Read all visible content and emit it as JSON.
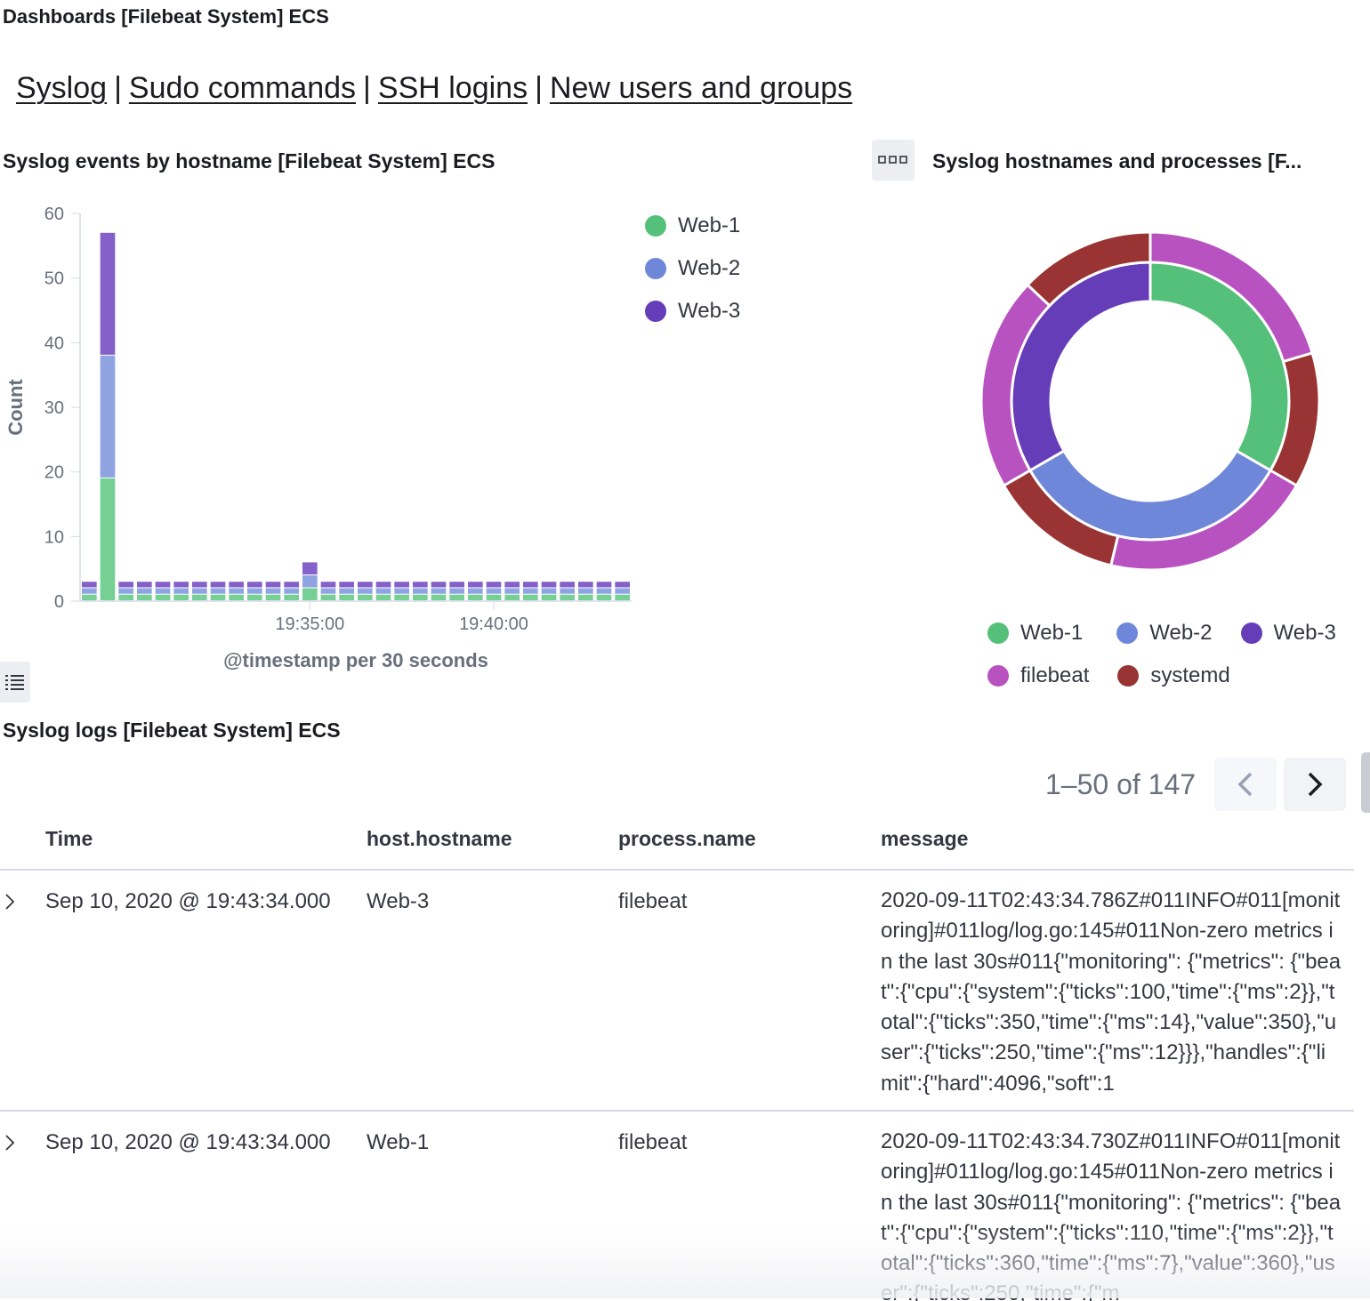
{
  "page_title": "Dashboards [Filebeat System] ECS",
  "nav": {
    "links": [
      "Syslog",
      "Sudo commands",
      "SSH logins",
      "New users and groups"
    ],
    "separator": "|"
  },
  "bar_panel": {
    "title": "Syslog events by hostname [Filebeat System] ECS",
    "legend": [
      {
        "label": "Web-1",
        "color": "#54b399"
      },
      {
        "label": "Web-2",
        "color": "#6f87d8"
      },
      {
        "label": "Web-3",
        "color": "#663db8"
      }
    ]
  },
  "donut_panel": {
    "title": "Syslog hostnames and processes [F...",
    "menu_icon": "ellipsis-icon",
    "legend": [
      {
        "label": "Web-1",
        "color": "#54c07a"
      },
      {
        "label": "Web-2",
        "color": "#6f87d8"
      },
      {
        "label": "Web-3",
        "color": "#663db8"
      },
      {
        "label": "filebeat",
        "color": "#b852c0"
      },
      {
        "label": "systemd",
        "color": "#9a3434"
      }
    ]
  },
  "chart_data": [
    {
      "type": "bar",
      "stacked": true,
      "title": "Syslog events by hostname [Filebeat System] ECS",
      "xlabel": "@timestamp per 30 seconds",
      "ylabel": "Count",
      "ylim": [
        0,
        60
      ],
      "yticks": [
        0,
        10,
        20,
        30,
        40,
        50,
        60
      ],
      "xtick_labels": [
        {
          "label": "19:35:00",
          "index": 12
        },
        {
          "label": "19:40:00",
          "index": 22
        }
      ],
      "bar_count": 30,
      "legend_position": "top-right",
      "series": [
        {
          "name": "Web-1",
          "color": "#76cf95",
          "values": [
            1,
            19,
            1,
            1,
            1,
            1,
            1,
            1,
            1,
            1,
            1,
            1,
            2,
            1,
            1,
            1,
            1,
            1,
            1,
            1,
            1,
            1,
            1,
            1,
            1,
            1,
            1,
            1,
            1,
            1
          ]
        },
        {
          "name": "Web-2",
          "color": "#8fa3e1",
          "values": [
            1,
            19,
            1,
            1,
            1,
            1,
            1,
            1,
            1,
            1,
            1,
            1,
            2,
            1,
            1,
            1,
            1,
            1,
            1,
            1,
            1,
            1,
            1,
            1,
            1,
            1,
            1,
            1,
            1,
            1
          ]
        },
        {
          "name": "Web-3",
          "color": "#8560c8",
          "values": [
            1,
            19,
            1,
            1,
            1,
            1,
            1,
            1,
            1,
            1,
            1,
            1,
            2,
            1,
            1,
            1,
            1,
            1,
            1,
            1,
            1,
            1,
            1,
            1,
            1,
            1,
            1,
            1,
            1,
            1
          ]
        }
      ]
    },
    {
      "type": "pie",
      "donut": true,
      "title": "Syslog hostnames and processes [F...",
      "inner_ring": [
        {
          "name": "Web-1",
          "value": 49,
          "color": "#54c07a"
        },
        {
          "name": "Web-2",
          "value": 49,
          "color": "#6f87d8"
        },
        {
          "name": "Web-3",
          "value": 49,
          "color": "#663db8"
        }
      ],
      "outer_ring": [
        {
          "name": "filebeat",
          "parent": "Web-1",
          "value": 30,
          "color": "#b852c0"
        },
        {
          "name": "systemd",
          "parent": "Web-1",
          "value": 19,
          "color": "#9a3434"
        },
        {
          "name": "filebeat",
          "parent": "Web-2",
          "value": 30,
          "color": "#b852c0"
        },
        {
          "name": "systemd",
          "parent": "Web-2",
          "value": 19,
          "color": "#9a3434"
        },
        {
          "name": "filebeat",
          "parent": "Web-3",
          "value": 30,
          "color": "#b852c0"
        },
        {
          "name": "systemd",
          "parent": "Web-3",
          "value": 19,
          "color": "#9a3434"
        }
      ],
      "legend_position": "bottom"
    }
  ],
  "logs_panel": {
    "title": "Syslog logs [Filebeat System] ECS",
    "pagination": {
      "text": "1–50 of 147"
    },
    "columns": [
      "Time",
      "host.hostname",
      "process.name",
      "message"
    ],
    "rows": [
      {
        "time": "Sep 10, 2020 @ 19:43:34.000",
        "hostname": "Web-3",
        "process": "filebeat",
        "message": "2020-09-11T02:43:34.786Z#011INFO#011[monitoring]#011log/log.go:145#011Non-zero metrics in the last 30s#011{\"monitoring\": {\"metrics\": {\"beat\":{\"cpu\":{\"system\":{\"ticks\":100,\"time\":{\"ms\":2}},\"total\":{\"ticks\":350,\"time\":{\"ms\":14},\"value\":350},\"user\":{\"ticks\":250,\"time\":{\"ms\":12}}},\"handles\":{\"limit\":{\"hard\":4096,\"soft\":1"
      },
      {
        "time": "Sep 10, 2020 @ 19:43:34.000",
        "hostname": "Web-1",
        "process": "filebeat",
        "message": "2020-09-11T02:43:34.730Z#011INFO#011[monitoring]#011log/log.go:145#011Non-zero metrics in the last 30s#011{\"monitoring\": {\"metrics\": {\"beat\":{\"cpu\":{\"system\":{\"ticks\":110,\"time\":{\"ms\":2}},\"total\":{\"ticks\":360,\"time\":{\"ms\":7},\"value\":360},\"user\":{\"ticks\":250,\"time\":{\"m"
      }
    ]
  }
}
